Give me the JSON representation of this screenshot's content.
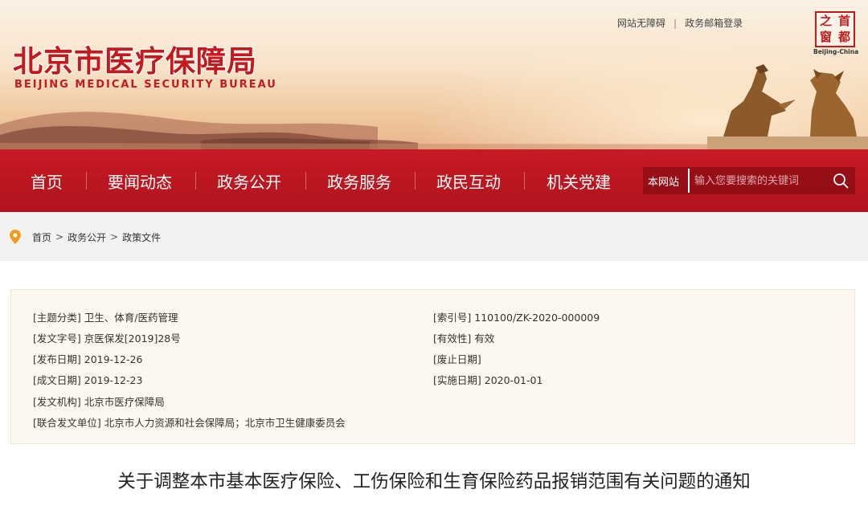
{
  "header": {
    "title": "北京市医疗保障局",
    "subtitle": "BEIJING MEDICAL SECURITY BUREAU",
    "links": [
      "网站无障碍",
      "政务邮箱登录"
    ],
    "seal_chars": [
      "之",
      "首",
      "窗",
      "都"
    ],
    "seal_label": "Beijing-China"
  },
  "nav": {
    "items": [
      "首页",
      "要闻动态",
      "政务公开",
      "政务服务",
      "政民互动",
      "机关党建"
    ],
    "search_scope": "本网站",
    "search_placeholder": "输入您要搜索的关键词"
  },
  "breadcrumb": [
    "首页",
    "政务公开",
    "政策文件"
  ],
  "meta": {
    "subject_label": "[主题分类]",
    "subject": "卫生、体育/医药管理",
    "doc_no_label": "[发文字号]",
    "doc_no": "京医保发[2019]28号",
    "publish_label": "[发布日期]",
    "publish": "2019-12-26",
    "written_label": "[成文日期]",
    "written": "2019-12-23",
    "issuer_label": "[发文机构]",
    "issuer": "北京市医疗保障局",
    "joint_label": "[联合发文单位]",
    "joint": "北京市人力资源和社会保障局；北京市卫生健康委员会",
    "index_label": "[索引号]",
    "index": "110100/ZK-2020-000009",
    "validity_label": "[有效性]",
    "validity": "有效",
    "repeal_label": "[废止日期]",
    "repeal": "",
    "effective_label": "[实施日期]",
    "effective": "2020-01-01"
  },
  "document": {
    "title": "关于调整本市基本医疗保险、工伤保险和生育保险药品报销范围有关问题的通知"
  },
  "colors": {
    "brand_red": "#c41a1e",
    "nav_red": "#b8161f",
    "meta_bg": "#fdf8ef",
    "pin_orange": "#f39a1e"
  }
}
